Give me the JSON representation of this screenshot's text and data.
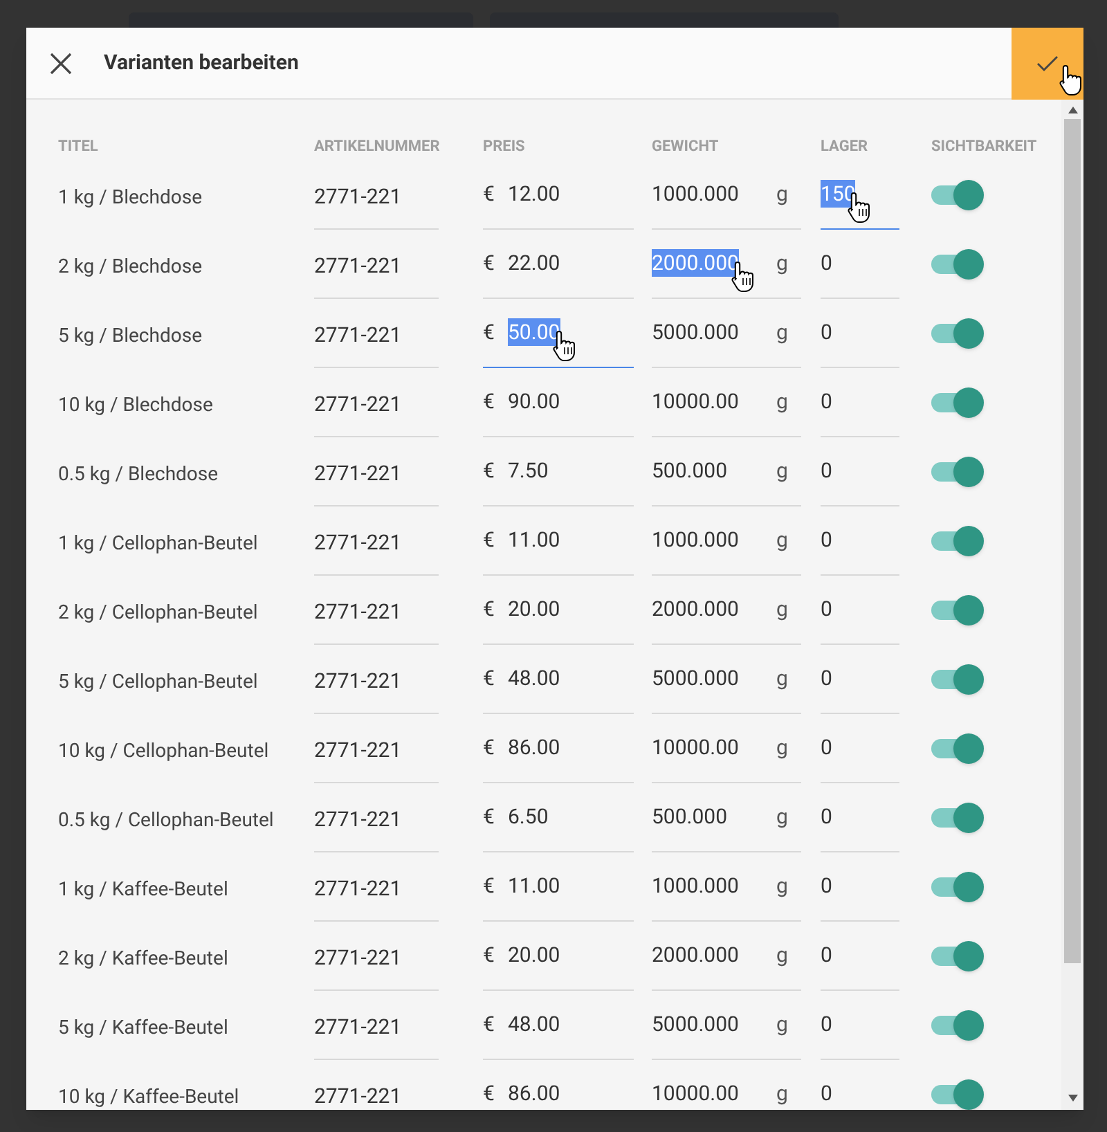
{
  "dialog": {
    "title": "Varianten bearbeiten"
  },
  "columns": [
    "TITEL",
    "ARTIKELNUMMER",
    "PREIS",
    "GEWICHT",
    "LAGER",
    "SICHTBARKEIT"
  ],
  "rows": [
    {
      "title": "1 kg / Blechdose",
      "sku": "2771-221",
      "currency": "€",
      "price": {
        "value": "12.00"
      },
      "weight": {
        "value": "1000.000"
      },
      "unit": "g",
      "stock": {
        "value": "150",
        "highlighted": true,
        "focused": true
      },
      "visible": true
    },
    {
      "title": "2 kg / Blechdose",
      "sku": "2771-221",
      "currency": "€",
      "price": {
        "value": "22.00"
      },
      "weight": {
        "value": "2000.000",
        "highlighted": true
      },
      "unit": "g",
      "stock": {
        "value": "0"
      },
      "visible": true
    },
    {
      "title": "5 kg / Blechdose",
      "sku": "2771-221",
      "currency": "€",
      "price": {
        "value": "50.00",
        "highlighted": true,
        "focused": true
      },
      "weight": {
        "value": "5000.000"
      },
      "unit": "g",
      "stock": {
        "value": "0"
      },
      "visible": true
    },
    {
      "title": "10 kg / Blechdose",
      "sku": "2771-221",
      "currency": "€",
      "price": {
        "value": "90.00"
      },
      "weight": {
        "value": "10000.00"
      },
      "unit": "g",
      "stock": {
        "value": "0"
      },
      "visible": true
    },
    {
      "title": "0.5 kg / Blechdose",
      "sku": "2771-221",
      "currency": "€",
      "price": {
        "value": "7.50"
      },
      "weight": {
        "value": "500.000"
      },
      "unit": "g",
      "stock": {
        "value": "0"
      },
      "visible": true
    },
    {
      "title": "1 kg / Cellophan-Beutel",
      "sku": "2771-221",
      "currency": "€",
      "price": {
        "value": "11.00"
      },
      "weight": {
        "value": "1000.000"
      },
      "unit": "g",
      "stock": {
        "value": "0"
      },
      "visible": true
    },
    {
      "title": "2 kg / Cellophan-Beutel",
      "sku": "2771-221",
      "currency": "€",
      "price": {
        "value": "20.00"
      },
      "weight": {
        "value": "2000.000"
      },
      "unit": "g",
      "stock": {
        "value": "0"
      },
      "visible": true
    },
    {
      "title": "5 kg / Cellophan-Beutel",
      "sku": "2771-221",
      "currency": "€",
      "price": {
        "value": "48.00"
      },
      "weight": {
        "value": "5000.000"
      },
      "unit": "g",
      "stock": {
        "value": "0"
      },
      "visible": true
    },
    {
      "title": "10 kg / Cellophan-Beutel",
      "sku": "2771-221",
      "currency": "€",
      "price": {
        "value": "86.00"
      },
      "weight": {
        "value": "10000.00"
      },
      "unit": "g",
      "stock": {
        "value": "0"
      },
      "visible": true
    },
    {
      "title": "0.5 kg / Cellophan-Beutel",
      "sku": "2771-221",
      "currency": "€",
      "price": {
        "value": "6.50"
      },
      "weight": {
        "value": "500.000"
      },
      "unit": "g",
      "stock": {
        "value": "0"
      },
      "visible": true
    },
    {
      "title": "1 kg / Kaffee-Beutel",
      "sku": "2771-221",
      "currency": "€",
      "price": {
        "value": "11.00"
      },
      "weight": {
        "value": "1000.000"
      },
      "unit": "g",
      "stock": {
        "value": "0"
      },
      "visible": true
    },
    {
      "title": "2 kg / Kaffee-Beutel",
      "sku": "2771-221",
      "currency": "€",
      "price": {
        "value": "20.00"
      },
      "weight": {
        "value": "2000.000"
      },
      "unit": "g",
      "stock": {
        "value": "0"
      },
      "visible": true
    },
    {
      "title": "5 kg / Kaffee-Beutel",
      "sku": "2771-221",
      "currency": "€",
      "price": {
        "value": "48.00"
      },
      "weight": {
        "value": "5000.000"
      },
      "unit": "g",
      "stock": {
        "value": "0"
      },
      "visible": true
    },
    {
      "title": "10 kg / Kaffee-Beutel",
      "sku": "2771-221",
      "currency": "€",
      "price": {
        "value": "86.00"
      },
      "weight": {
        "value": "10000.00"
      },
      "unit": "g",
      "stock": {
        "value": "0"
      },
      "visible": true
    }
  ]
}
